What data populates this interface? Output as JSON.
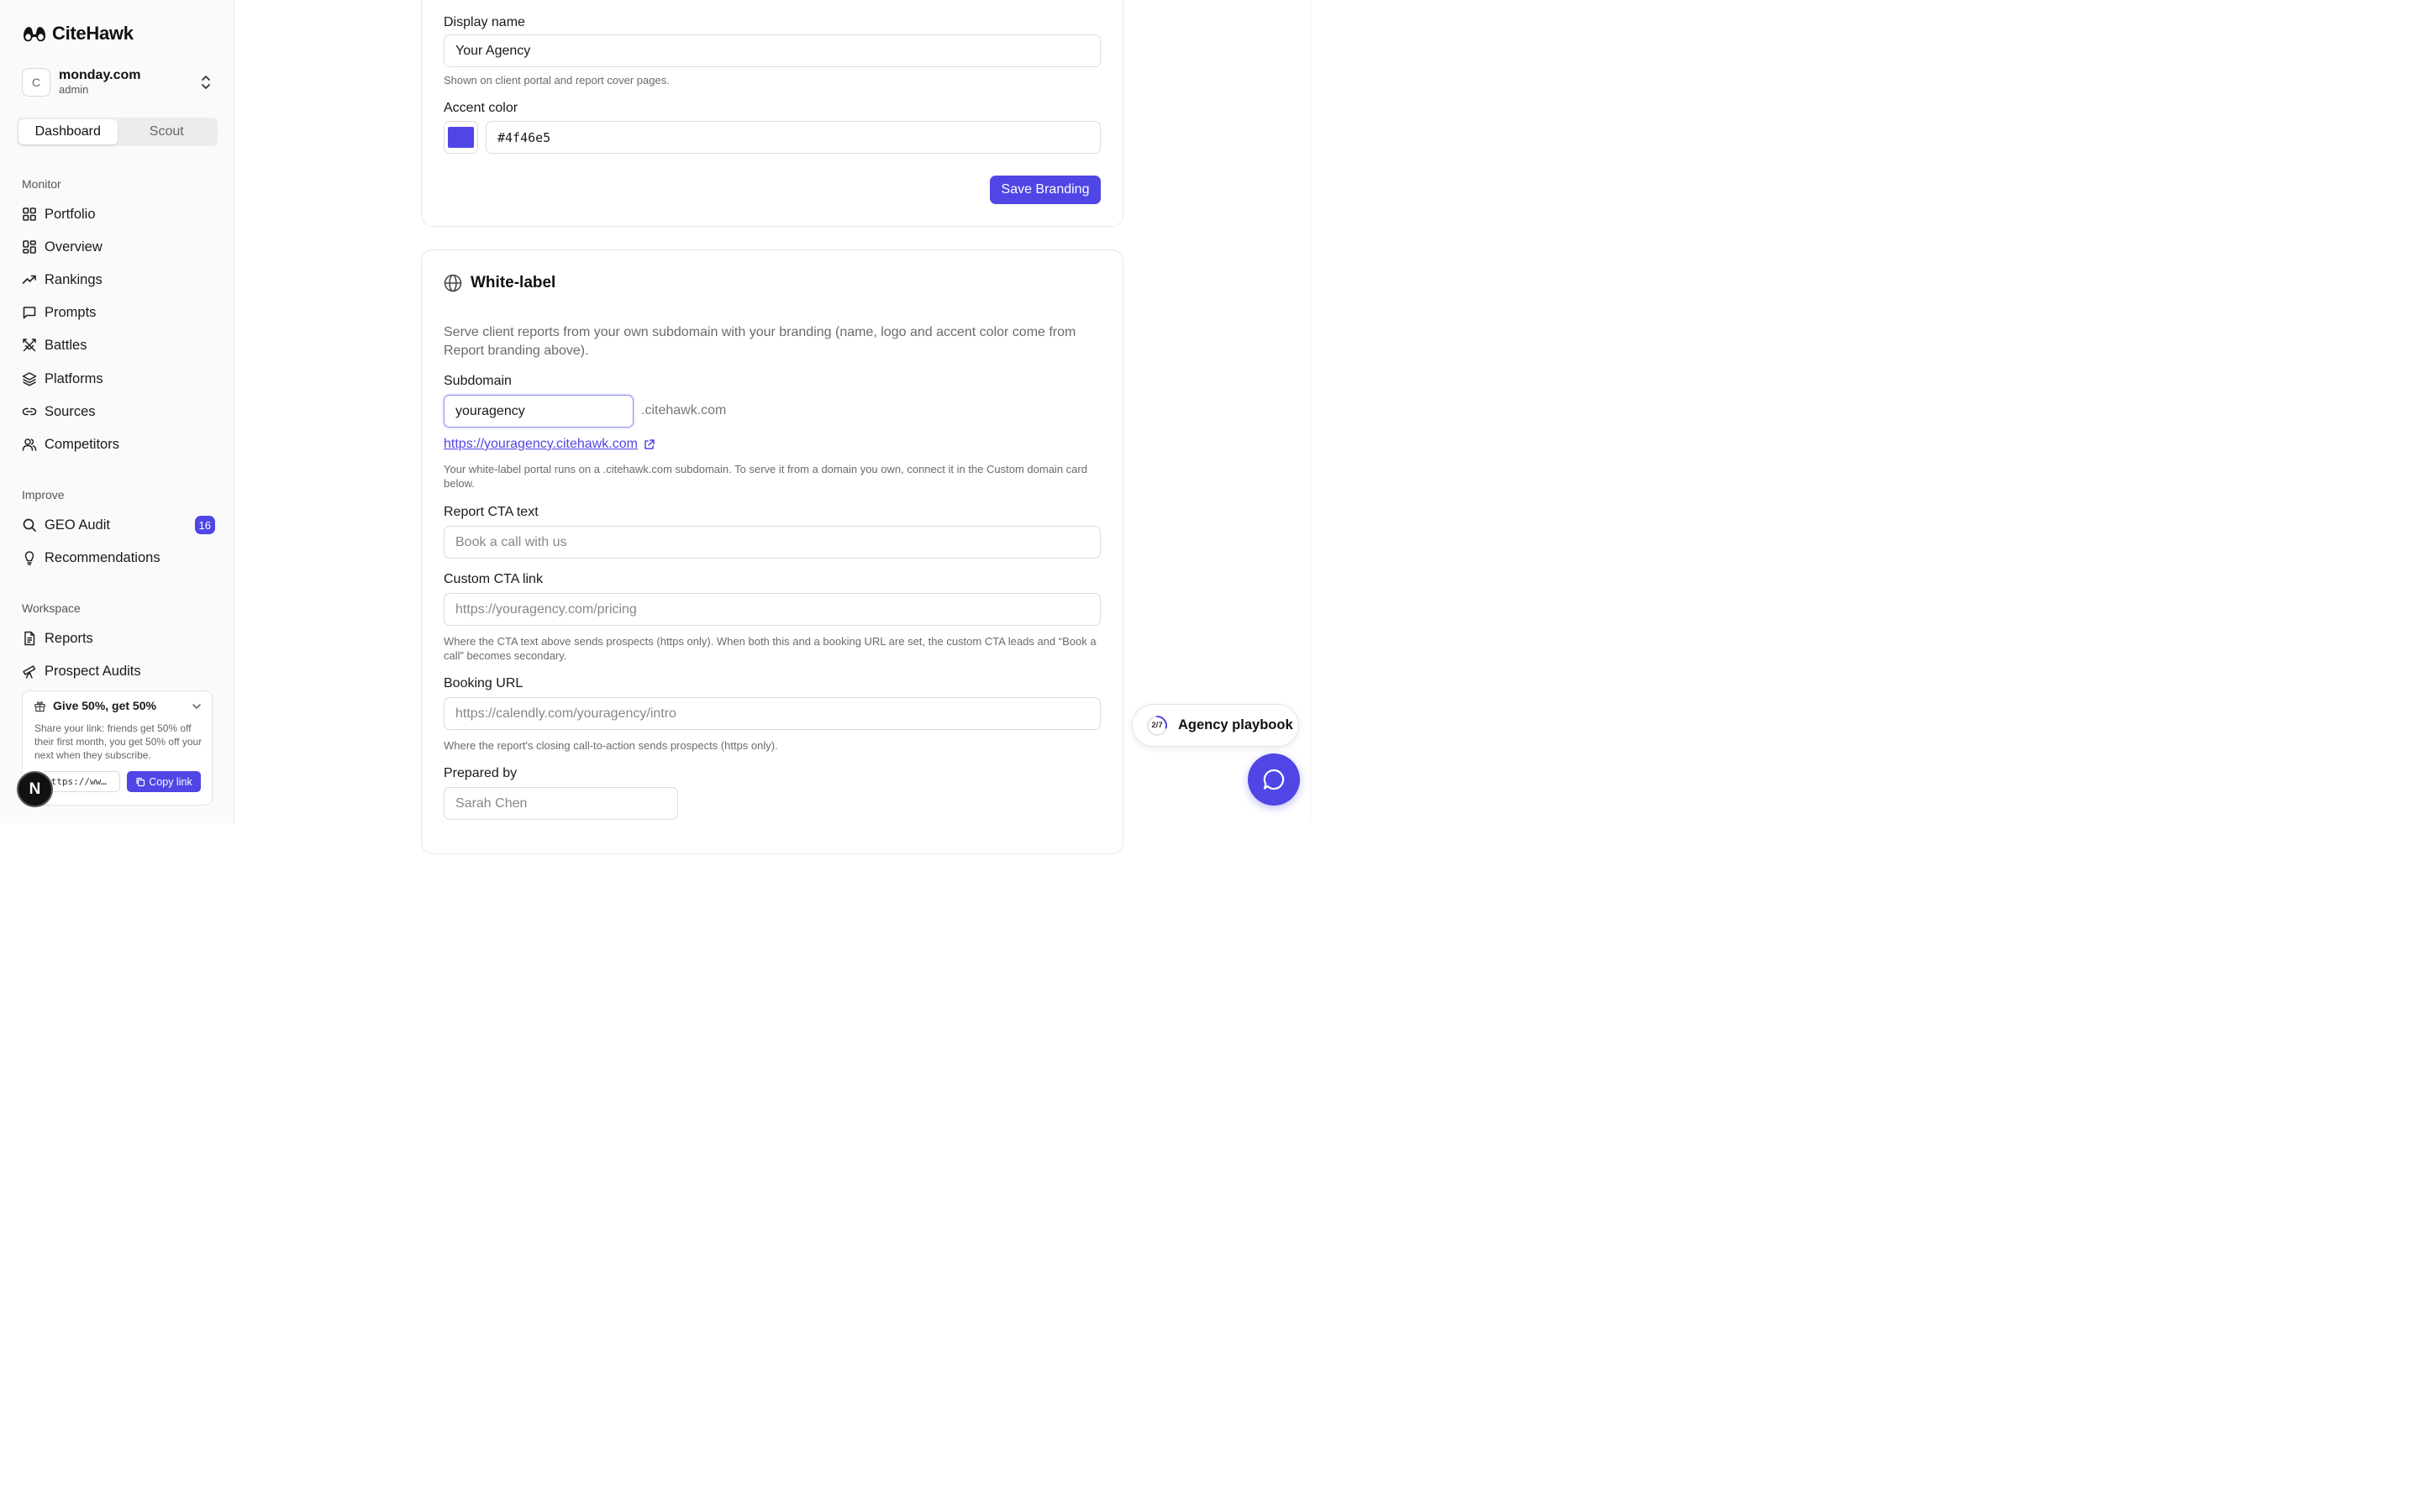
{
  "brand": {
    "name": "CiteHawk",
    "accent": "#4f46e5"
  },
  "workspace": {
    "avatar_letter": "C",
    "name": "monday.com",
    "role": "admin"
  },
  "mode_tabs": [
    {
      "label": "Dashboard",
      "active": true
    },
    {
      "label": "Scout",
      "active": false
    }
  ],
  "sidebar": {
    "monitor": {
      "label": "Monitor",
      "items": [
        {
          "label": "Portfolio",
          "icon": "grid-icon"
        },
        {
          "label": "Overview",
          "icon": "dashboard-icon"
        },
        {
          "label": "Rankings",
          "icon": "trending-up-icon"
        },
        {
          "label": "Prompts",
          "icon": "message-square-icon"
        },
        {
          "label": "Battles",
          "icon": "swords-icon"
        },
        {
          "label": "Platforms",
          "icon": "layers-icon"
        },
        {
          "label": "Sources",
          "icon": "link-icon"
        },
        {
          "label": "Competitors",
          "icon": "users-icon"
        }
      ]
    },
    "improve": {
      "label": "Improve",
      "items": [
        {
          "label": "GEO Audit",
          "icon": "search-icon",
          "badge": "16"
        },
        {
          "label": "Recommendations",
          "icon": "lightbulb-icon"
        }
      ]
    },
    "workspace": {
      "label": "Workspace",
      "items": [
        {
          "label": "Reports",
          "icon": "file-text-icon"
        },
        {
          "label": "Prospect Audits",
          "icon": "telescope-icon"
        }
      ]
    }
  },
  "referral": {
    "title": "Give 50%, get 50%",
    "body": "Share your link: friends get 50% off their first month, you get 50% off your next when they subscribe.",
    "link_value": "https://ww…",
    "copy_label": "Copy link"
  },
  "next_badge": "N",
  "branding": {
    "display_name_label": "Display name",
    "display_name_value": "Your Agency",
    "display_name_help": "Shown on client portal and report cover pages.",
    "accent_label": "Accent color",
    "accent_value": "#4f46e5",
    "save_label": "Save Branding"
  },
  "white_label": {
    "title": "White-label",
    "description": "Serve client reports from your own subdomain with your branding (name, logo and accent color come from Report branding above).",
    "subdomain_label": "Subdomain",
    "subdomain_value": "youragency",
    "subdomain_suffix": ".citehawk.com",
    "portal_url": "https://youragency.citehawk.com",
    "subdomain_help": "Your white-label portal runs on a .citehawk.com subdomain. To serve it from a domain you own, connect it in the Custom domain card below.",
    "cta_text_label": "Report CTA text",
    "cta_text_placeholder": "Book a call with us",
    "cta_link_label": "Custom CTA link",
    "cta_link_placeholder": "https://youragency.com/pricing",
    "cta_link_help": "Where the CTA text above sends prospects (https only). When both this and a booking URL are set, the custom CTA leads and “Book a call” becomes secondary.",
    "booking_label": "Booking URL",
    "booking_placeholder": "https://calendly.com/youragency/intro",
    "booking_help": "Where the report's closing call-to-action sends prospects (https only).",
    "prepared_label": "Prepared by",
    "prepared_placeholder": "Sarah Chen"
  },
  "playbook": {
    "label": "Agency playbook",
    "progress_text": "2/7",
    "progress_fraction": 0.2857
  }
}
